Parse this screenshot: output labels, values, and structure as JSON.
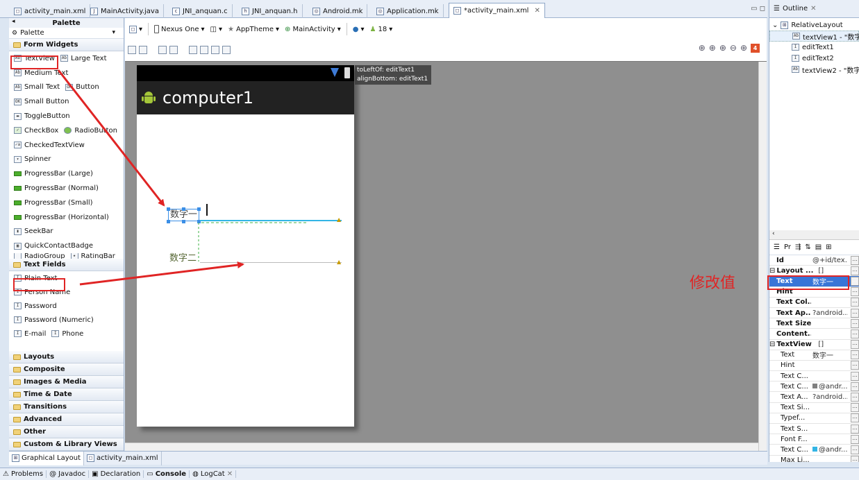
{
  "tabs": [
    {
      "label": "activity_main.xml",
      "icon": "xml-file-icon"
    },
    {
      "label": "MainActivity.java",
      "icon": "java-file-icon"
    },
    {
      "label": "JNI_anquan.c",
      "icon": "c-file-icon"
    },
    {
      "label": "JNI_anquan.h",
      "icon": "h-file-icon"
    },
    {
      "label": "Android.mk",
      "icon": "mk-file-icon"
    },
    {
      "label": "Application.mk",
      "icon": "mk-file-icon"
    },
    {
      "label": "*activity_main.xml",
      "icon": "xml-file-icon",
      "close": "✕"
    }
  ],
  "palette": {
    "title": "Palette",
    "dropdown": "Palette",
    "form_widgets": "Form Widgets",
    "widgets": [
      [
        "TextView",
        "Large Text"
      ],
      [
        "Medium Text"
      ],
      [
        "Small Text",
        "Button"
      ],
      [
        "Small Button"
      ],
      [
        "ToggleButton"
      ],
      [
        "CheckBox",
        "RadioButton"
      ],
      [
        "CheckedTextView"
      ],
      [
        "Spinner"
      ],
      [
        "ProgressBar (Large)"
      ],
      [
        "ProgressBar (Normal)"
      ],
      [
        "ProgressBar (Small)"
      ],
      [
        "ProgressBar (Horizontal)"
      ],
      [
        "SeekBar"
      ],
      [
        "QuickContactBadge"
      ],
      [
        "RadioGroup",
        "RatingBar"
      ]
    ],
    "text_fields": "Text Fields",
    "fields": [
      [
        "Plain Text"
      ],
      [
        "Person Name"
      ],
      [
        "Password"
      ],
      [
        "Password (Numeric)"
      ],
      [
        "E-mail",
        "Phone"
      ]
    ],
    "categories": [
      "Layouts",
      "Composite",
      "Images & Media",
      "Time & Date",
      "Transitions",
      "Advanced",
      "Other",
      "Custom & Library Views"
    ]
  },
  "toolbar": {
    "device": "Nexus One",
    "theme": "AppTheme",
    "activity": "MainActivity",
    "api": "18",
    "error_count": "4"
  },
  "device": {
    "app_title": "computer1",
    "text1": "数字一",
    "text2": "数字二",
    "tooltip_line1": "toLeftOf: editText1",
    "tooltip_line2": "alignBottom: editText1"
  },
  "outline": {
    "tab": "Outline",
    "root": "RelativeLayout",
    "items": [
      "textView1 - \"数字",
      "editText1",
      "editText2",
      "textView2 - \"数字"
    ]
  },
  "properties": {
    "tab_label": "Pr",
    "rows": [
      {
        "key": "Id",
        "value": "@+id/tex...",
        "style": "bold"
      },
      {
        "key": "Layout ...",
        "value": "[]",
        "style": "group"
      },
      {
        "key": "Text",
        "value": "数字一",
        "style": "sel"
      },
      {
        "key": "Hint",
        "value": "",
        "style": "bold"
      },
      {
        "key": "Text Col...",
        "value": "",
        "style": "bold"
      },
      {
        "key": "Text Ap...",
        "value": "?android...",
        "style": "bold"
      },
      {
        "key": "Text Size",
        "value": "",
        "style": "bold"
      },
      {
        "key": "Content...",
        "value": "",
        "style": "bold"
      },
      {
        "key": "TextView",
        "value": "[]",
        "style": "group"
      },
      {
        "key": "Text",
        "value": "数字一",
        "style": "indent"
      },
      {
        "key": "Hint",
        "value": "",
        "style": "indent"
      },
      {
        "key": "Text C...",
        "value": "",
        "style": "indent"
      },
      {
        "key": "Text C...",
        "value": "@andr...",
        "style": "indent",
        "swatch": "#808080"
      },
      {
        "key": "Text A...",
        "value": "?android...",
        "style": "indent"
      },
      {
        "key": "Text Si...",
        "value": "",
        "style": "indent"
      },
      {
        "key": "Typef...",
        "value": "",
        "style": "indent"
      },
      {
        "key": "Text S...",
        "value": "",
        "style": "indent"
      },
      {
        "key": "Font F...",
        "value": "",
        "style": "indent"
      },
      {
        "key": "Text C...",
        "value": "@andr...",
        "style": "indent",
        "swatch": "#33b5e5"
      },
      {
        "key": "Max Li...",
        "value": "",
        "style": "indent"
      }
    ]
  },
  "editor_tabs": [
    "Graphical Layout",
    "activity_main.xml"
  ],
  "bottom_tabs": [
    "Problems",
    "Javadoc",
    "Declaration",
    "Console",
    "LogCat"
  ],
  "annotation": "修改值",
  "colors": {
    "accent_red": "#e02424",
    "selection_blue": "#3875d7"
  }
}
